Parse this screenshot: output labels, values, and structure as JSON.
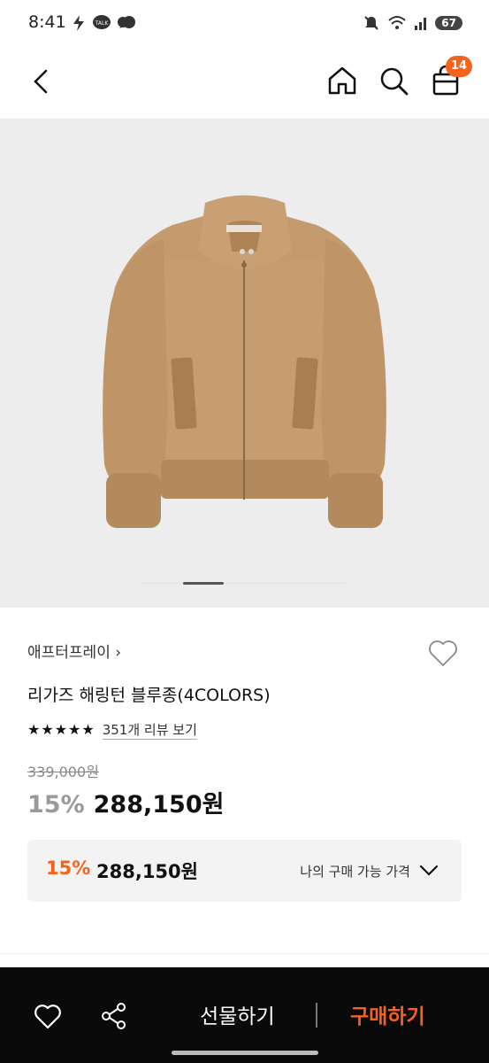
{
  "status": {
    "time": "8:41",
    "battery": "67"
  },
  "nav": {
    "cart_count": "14"
  },
  "product": {
    "brand": "애프터프레이",
    "brand_chevron": "›",
    "title": "리가즈 해링턴 블루종(4COLORS)",
    "stars": "★★★★★",
    "review_text": "351개 리뷰 보기",
    "original_price": "339,000원",
    "discount_percent": "15%",
    "sale_price": "288,150원",
    "image_page": 1,
    "image_pages": 4
  },
  "my_price": {
    "discount_percent": "15%",
    "price": "288,150원",
    "label": "나의 구매 가능 가격"
  },
  "bottom_bar": {
    "gift_label": "선물하기",
    "buy_label": "구매하기"
  },
  "colors": {
    "accent": "#f4631e",
    "bottom_bg": "#0a0a0a"
  }
}
